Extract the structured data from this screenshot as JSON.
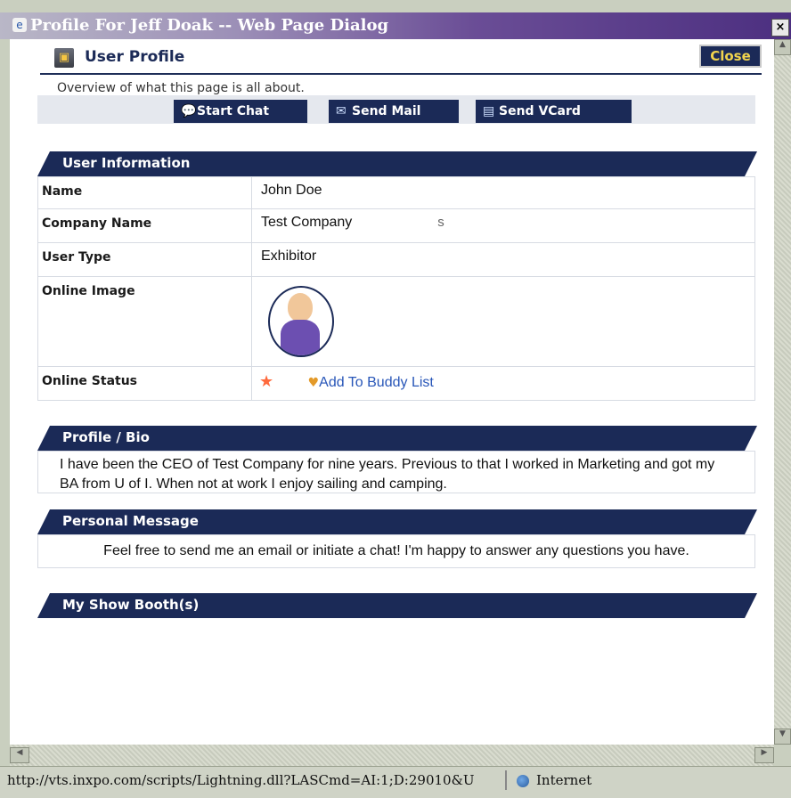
{
  "window": {
    "title": "Profile For Jeff Doak -- Web Page Dialog",
    "close_glyph": "×"
  },
  "header": {
    "title": "User Profile",
    "close_label": "Close"
  },
  "overview": "Overview of what this page is all about.",
  "actions": {
    "chat": "Start Chat",
    "mail": "Send Mail",
    "vcard": "Send VCard"
  },
  "sections": {
    "user_info": "User Information",
    "bio": "Profile / Bio",
    "message": "Personal Message",
    "booths": "My Show Booth(s)"
  },
  "user_info": {
    "name_label": "Name",
    "name_value": "John Doe",
    "company_label": "Company Name",
    "company_value": "Test Company",
    "company_residue": "s",
    "type_label": "User Type",
    "type_value": "Exhibitor",
    "image_label": "Online Image",
    "status_label": "Online Status",
    "buddy_link": "Add To Buddy List"
  },
  "bio": "I have been the CEO of Test Company for nine years. Previous to that I worked in Marketing and got my BA from U of I. When not at work I enjoy sailing and camping.",
  "message": "Feel free to send me an email or initiate a chat! I'm happy to answer any questions you have.",
  "status_bar": {
    "url": "http://vts.inxpo.com/scripts/Lightning.dll?LASCmd=AI:1;D:29010&U",
    "zone": "Internet"
  },
  "icons": [
    "ie-dialog-icon",
    "profile-icon",
    "chat-icon",
    "mail-icon",
    "vcard-icon",
    "star-icon",
    "buddy-icon",
    "globe-icon"
  ]
}
